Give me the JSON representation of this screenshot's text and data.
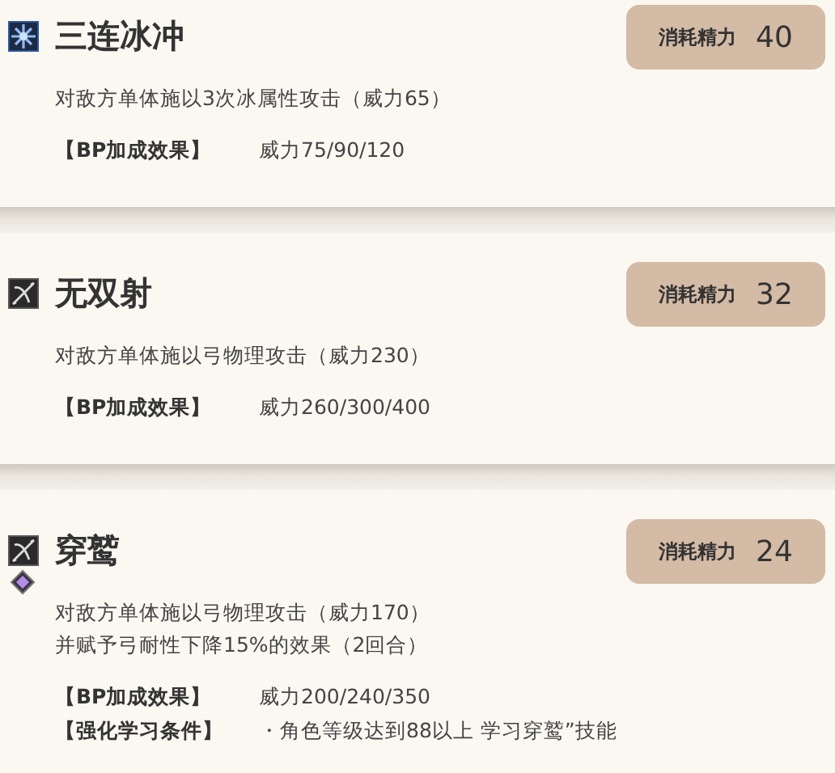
{
  "skills": [
    {
      "icons": [
        {
          "kind": "ice"
        }
      ],
      "name": "三连冰冲",
      "cost_label": "消耗精力",
      "cost": "40",
      "description": [
        "对敌方单体施以3次冰属性攻击（威力65）"
      ],
      "effects": [
        {
          "label": "【BP加成效果】",
          "value": "威力75/90/120"
        }
      ]
    },
    {
      "icons": [
        {
          "kind": "bow"
        }
      ],
      "name": "无双射",
      "cost_label": "消耗精力",
      "cost": "32",
      "description": [
        "对敌方单体施以弓物理攻击（威力230）"
      ],
      "effects": [
        {
          "label": "【BP加成效果】",
          "value": "威力260/300/400"
        }
      ]
    },
    {
      "icons": [
        {
          "kind": "bow"
        },
        {
          "kind": "diamond"
        }
      ],
      "name": "穿鹫",
      "cost_label": "消耗精力",
      "cost": "24",
      "description": [
        "对敌方单体施以弓物理攻击（威力170）",
        "并赋予弓耐性下降15%的效果（2回合）"
      ],
      "effects": [
        {
          "label": "【BP加成效果】",
          "value": "威力200/240/350"
        },
        {
          "label": "【强化学习条件】",
          "value": "・角色等级达到88以上 学习穿鹫”技能"
        }
      ]
    }
  ]
}
